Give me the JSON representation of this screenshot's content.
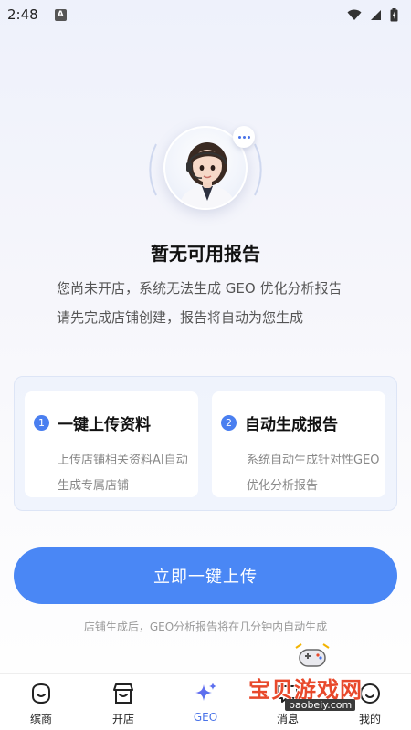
{
  "status_bar": {
    "time": "2:48",
    "notification_icon": "A",
    "icons": [
      "wifi-icon",
      "signal-icon",
      "battery-icon"
    ]
  },
  "empty_state": {
    "title": "暂无可用报告",
    "description": "您尚未开店，系统无法生成 GEO 优化分析报告 请先完成店铺创建，报告将自动为您生成"
  },
  "steps": [
    {
      "number": "1",
      "title": "一键上传资料",
      "description": "上传店铺相关资料AI自动生成专属店铺"
    },
    {
      "number": "2",
      "title": "自动生成报告",
      "description": "系统自动生成针对性GEO 优化分析报告"
    }
  ],
  "primary_button": {
    "label": "立即一键上传"
  },
  "footnote": "店铺生成后，GEO分析报告将在几分钟内自动生成",
  "tabs": [
    {
      "label": "缤商",
      "icon": "face-icon"
    },
    {
      "label": "开店",
      "icon": "store-icon"
    },
    {
      "label": "GEO",
      "icon": "sparkle-icon",
      "active": true
    },
    {
      "label": "消息",
      "icon": "message-icon"
    },
    {
      "label": "我的",
      "icon": "profile-icon"
    }
  ],
  "watermark": {
    "text": "宝贝游戏网",
    "url": "baobeiy.com"
  },
  "colors": {
    "accent": "#4a87f5",
    "active_tab": "#4a73e8",
    "watermark": "#e8492b"
  }
}
